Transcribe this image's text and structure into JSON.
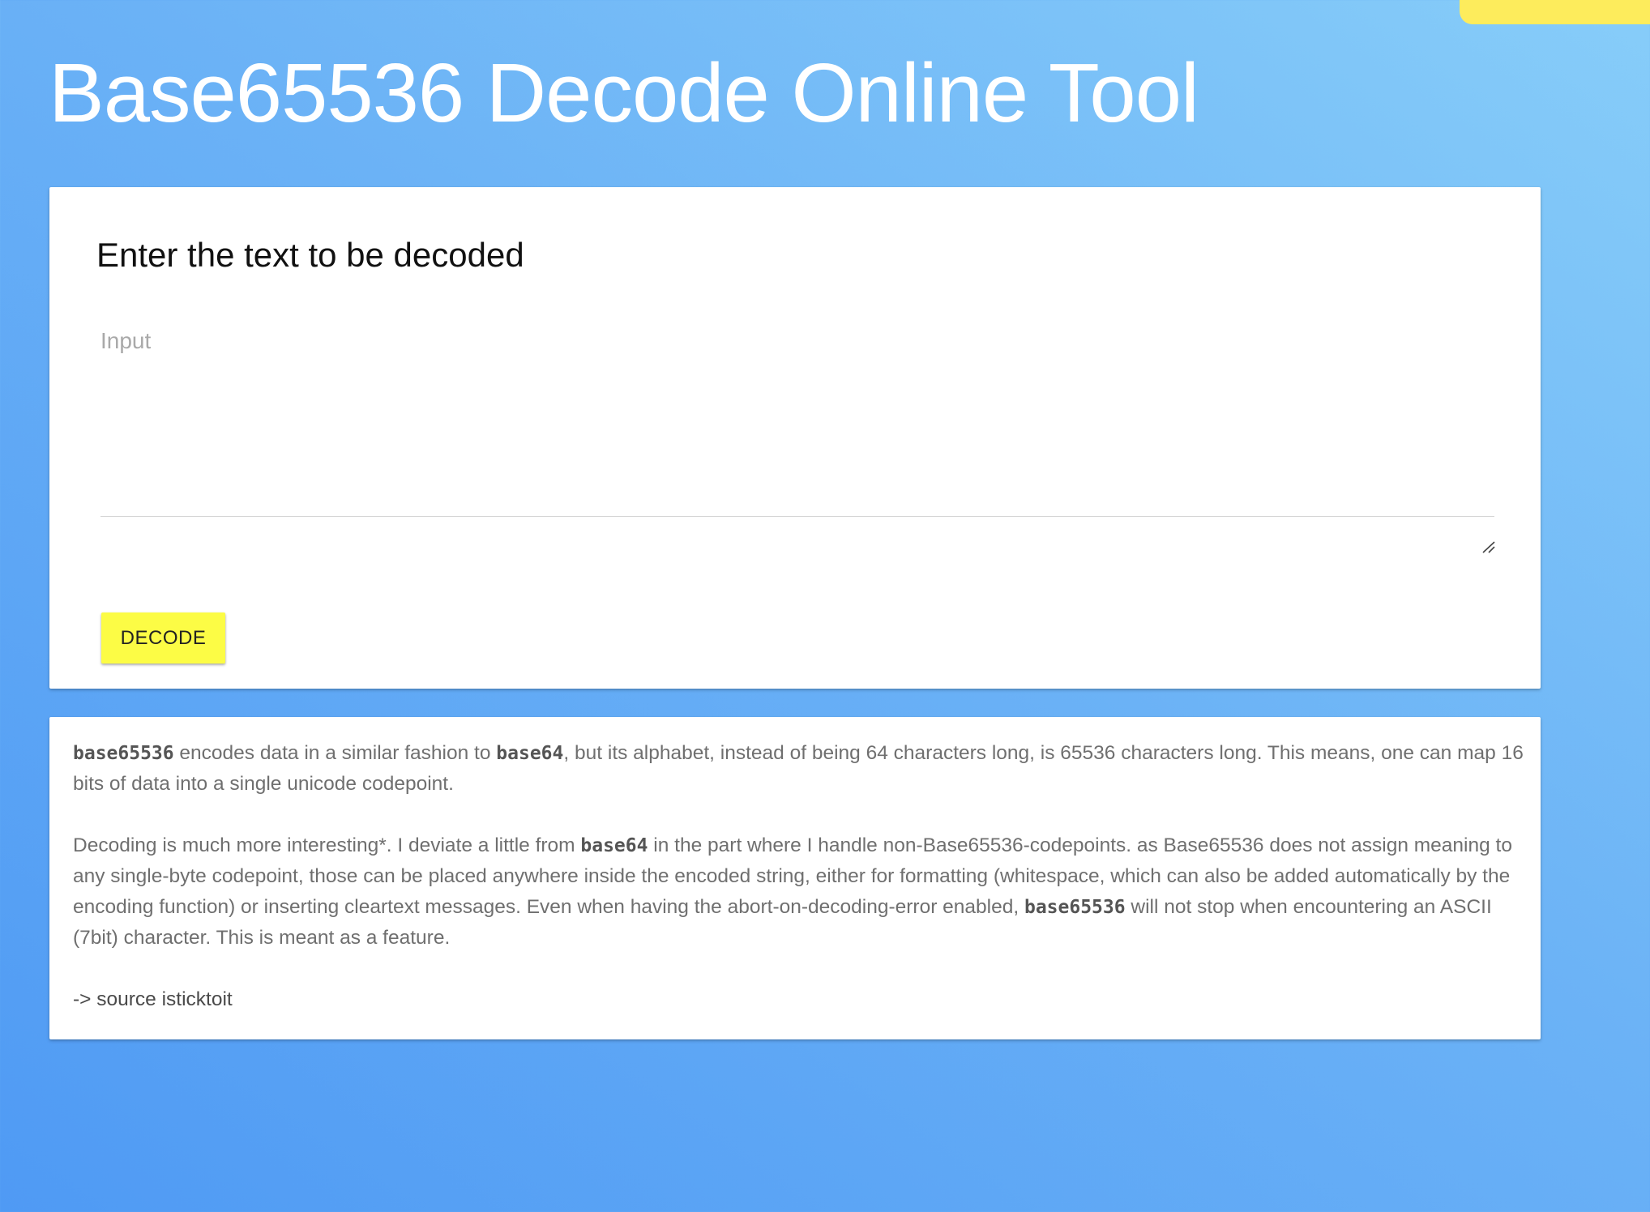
{
  "page": {
    "title": "Base65536 Decode Online Tool"
  },
  "input_card": {
    "title": "Enter the text to be decoded",
    "input_placeholder": "Input",
    "input_value": "",
    "decode_label": "DECODE"
  },
  "info": {
    "p1": {
      "code1": "base65536",
      "t1": " encodes data in a similar fashion to ",
      "code2": "base64",
      "t2": ", but its alphabet, instead of being 64 characters long, is 65536 characters long. This means, one can map 16 bits of data into a single unicode codepoint."
    },
    "p2": {
      "t1": "Decoding is much more interesting*. I deviate a little from ",
      "code1": "base64",
      "t2": " in the part where I handle non-Base65536-codepoints. as Base65536 does not assign meaning to any single-byte codepoint, those can be placed anywhere inside the encoded string, either for formatting (whitespace, which can also be added automatically by the encoding function) or inserting cleartext messages. Even when having the abort-on-decoding-error enabled, ",
      "code2": "base65536",
      "t3": " will not stop when encountering an ASCII (7bit) character. This is meant as a feature."
    },
    "source_line": "-> source isticktoit"
  },
  "colors": {
    "background_start": "#4f9af4",
    "background_end": "#87cdf9",
    "button": "#fcfc45",
    "corner_tab": "#fdec5c"
  },
  "icons": {
    "resize_grip": "resize-grip-icon"
  }
}
